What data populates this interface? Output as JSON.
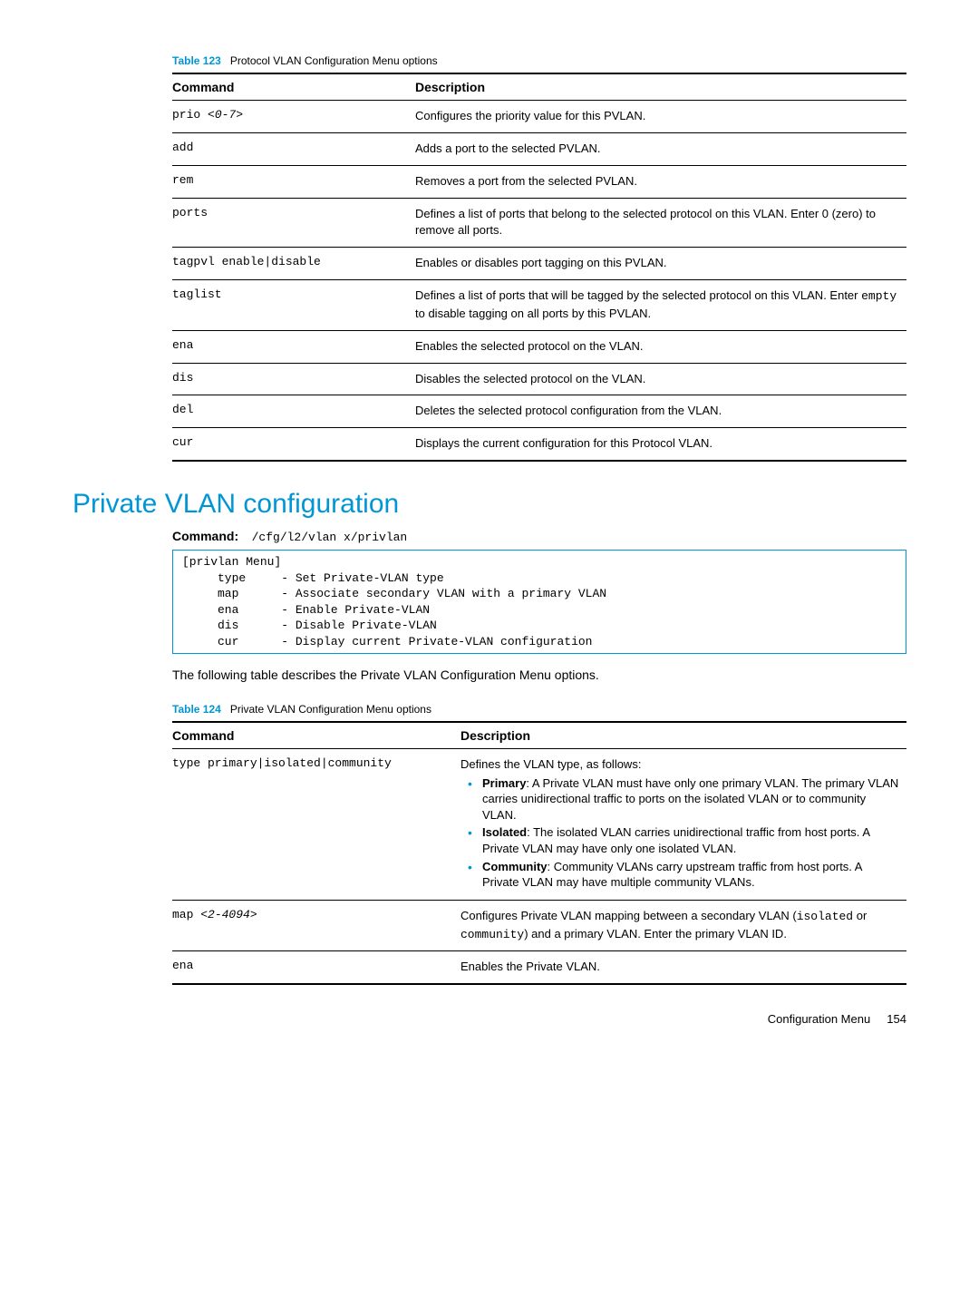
{
  "table123": {
    "caption_label": "Table 123",
    "caption_title": "Protocol VLAN Configuration Menu options",
    "col_command": "Command",
    "col_description": "Description",
    "rows": [
      {
        "cmd_prefix": "prio ",
        "cmd_arg": "<0-7>",
        "desc": "Configures the priority value for this PVLAN."
      },
      {
        "cmd": "add",
        "desc": "Adds a port to the selected PVLAN."
      },
      {
        "cmd": "rem",
        "desc": "Removes a port from the selected PVLAN."
      },
      {
        "cmd": "ports",
        "desc": "Defines a list of ports that belong to the selected protocol on this VLAN. Enter 0 (zero) to remove all ports."
      },
      {
        "cmd": "tagpvl enable|disable",
        "desc": "Enables or disables port tagging on this PVLAN."
      },
      {
        "cmd": "taglist",
        "desc_pre": "Defines a list of ports that will be tagged by the selected protocol on this VLAN. Enter ",
        "desc_mono": "empty",
        "desc_post": " to disable tagging on all ports by this PVLAN."
      },
      {
        "cmd": "ena",
        "desc": "Enables the selected protocol on the VLAN."
      },
      {
        "cmd": "dis",
        "desc": "Disables the selected protocol on the VLAN."
      },
      {
        "cmd": "del",
        "desc": "Deletes the selected protocol configuration from the VLAN."
      },
      {
        "cmd": "cur",
        "desc": "Displays the current configuration for this Protocol VLAN."
      }
    ]
  },
  "section": {
    "title": "Private VLAN configuration",
    "command_label": "Command:",
    "command_value": "/cfg/l2/vlan x/privlan",
    "menu_text": "[privlan Menu]\n     type     - Set Private-VLAN type\n     map      - Associate secondary VLAN with a primary VLAN\n     ena      - Enable Private-VLAN\n     dis      - Disable Private-VLAN\n     cur      - Display current Private-VLAN configuration",
    "intro_paragraph": "The following table describes the Private VLAN Configuration Menu options."
  },
  "table124": {
    "caption_label": "Table 124",
    "caption_title": "Private VLAN Configuration Menu options",
    "col_command": "Command",
    "col_description": "Description",
    "row_type": {
      "cmd": "type primary|isolated|community",
      "lead": "Defines the VLAN type, as follows:",
      "bullets": [
        {
          "bold": "Primary",
          "text": ": A Private VLAN must have only one primary VLAN. The primary VLAN carries unidirectional traffic to ports on the isolated VLAN or to community VLAN."
        },
        {
          "bold": "Isolated",
          "text": ": The isolated VLAN carries unidirectional traffic from host ports. A Private VLAN may have only one isolated VLAN."
        },
        {
          "bold": "Community",
          "text": ": Community VLANs carry upstream traffic from host ports. A Private VLAN may have multiple community VLANs."
        }
      ]
    },
    "row_map": {
      "cmd_prefix": "map ",
      "cmd_arg": "<2-4094>",
      "desc_pre": "Configures Private VLAN mapping between a secondary VLAN (",
      "mono1": "isolated",
      "mid": " or ",
      "mono2": "community",
      "desc_post": ") and a primary VLAN. Enter the primary VLAN ID."
    },
    "row_ena": {
      "cmd": "ena",
      "desc": "Enables the Private VLAN."
    }
  },
  "footer": {
    "text": "Configuration Menu",
    "page": "154"
  }
}
